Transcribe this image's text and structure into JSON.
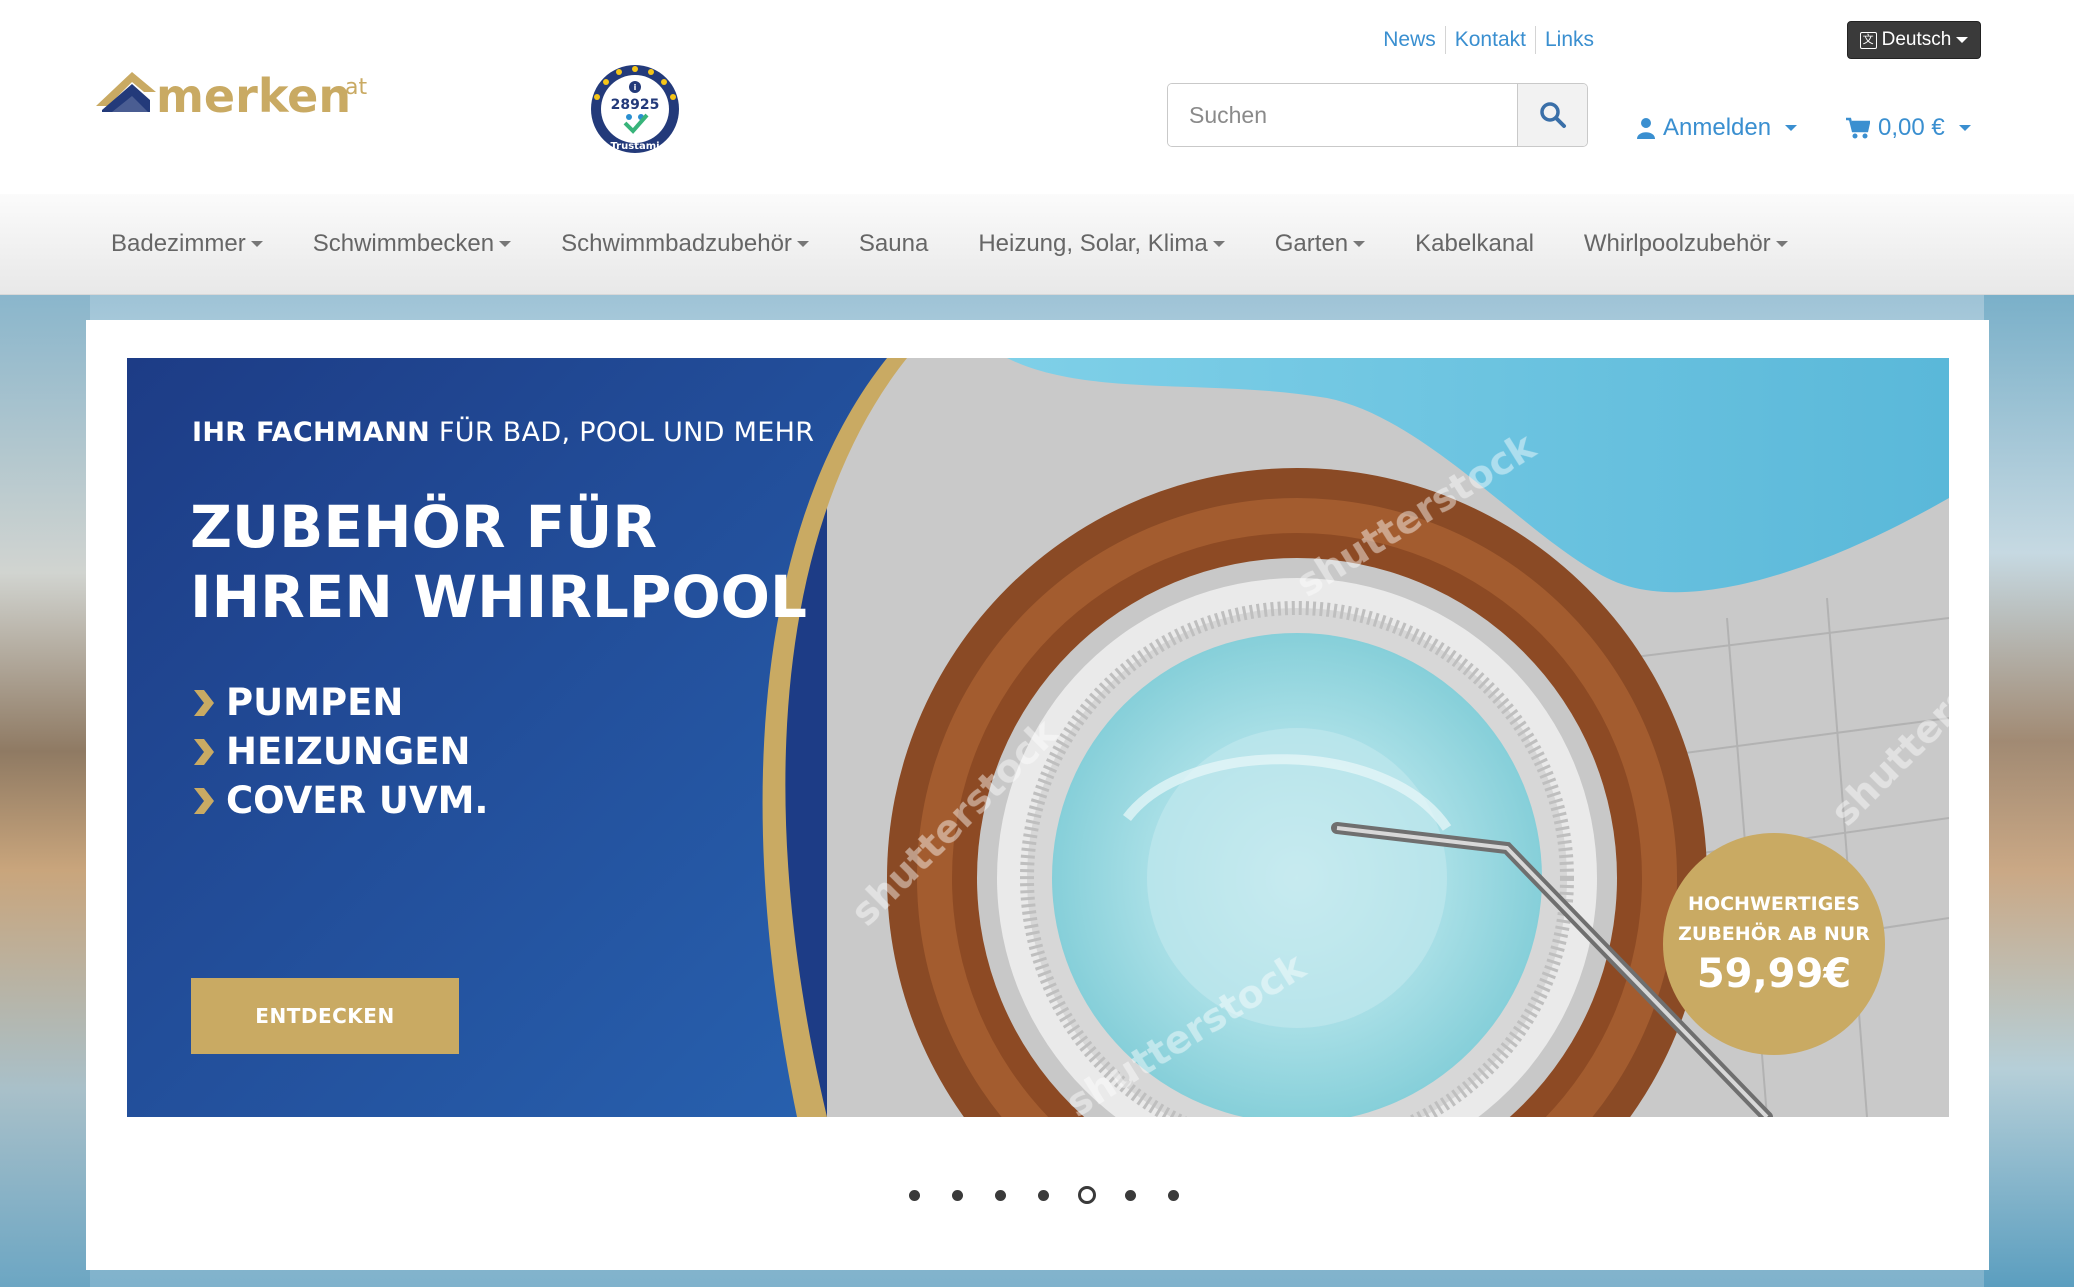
{
  "header": {
    "logo_alt": "merken.at",
    "logo_word": "merken",
    "logo_tld": ".at",
    "trust_number": "28925",
    "trust_label": "Trustami",
    "toplinks": [
      "News",
      "Kontakt",
      "Links"
    ],
    "language": "Deutsch",
    "search_placeholder": "Suchen",
    "account_label": "Anmelden",
    "cart_total": "0,00 €"
  },
  "nav": {
    "items": [
      {
        "label": "Badezimmer",
        "has_dropdown": true
      },
      {
        "label": "Schwimmbecken",
        "has_dropdown": true
      },
      {
        "label": "Schwimmbadzubehör",
        "has_dropdown": true
      },
      {
        "label": "Sauna",
        "has_dropdown": false
      },
      {
        "label": "Heizung, Solar, Klima",
        "has_dropdown": true
      },
      {
        "label": "Garten",
        "has_dropdown": true
      },
      {
        "label": "Kabelkanal",
        "has_dropdown": false
      },
      {
        "label": "Whirlpoolzubehör",
        "has_dropdown": true
      }
    ]
  },
  "banner": {
    "tag_bold": "IHR FACHMANN",
    "tag_rest": " FÜR BAD, POOL UND MEHR",
    "title_line1": "ZUBEHÖR FÜR",
    "title_line2": "IHREN WHIRLPOOL",
    "list": [
      "PUMPEN",
      "HEIZUNGEN",
      "COVER UVM."
    ],
    "cta": "ENTDECKEN",
    "badge_line1": "HOCHWERTIGES",
    "badge_line2": "ZUBEHÖR AB NUR",
    "badge_price": "59,99€",
    "watermark": "shutterstock"
  },
  "slider": {
    "slide_count": 7,
    "active_slide": 5
  },
  "colors": {
    "link_blue": "#3a8fd0",
    "banner_blue": "#1d3c86",
    "gold": "#c9aa63",
    "logo_navy": "#233a7a"
  }
}
